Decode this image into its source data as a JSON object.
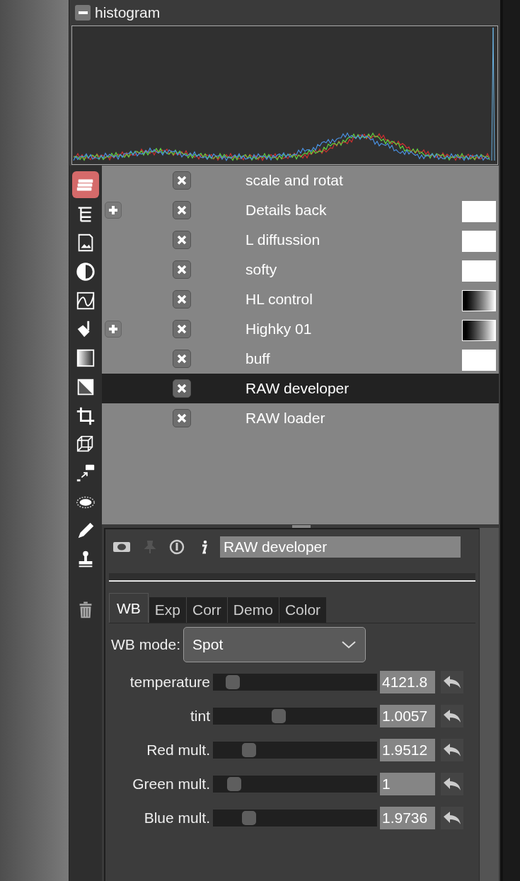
{
  "histogram": {
    "title": "histogram",
    "expanded": true
  },
  "tools": [
    {
      "kind": "layers",
      "selected": true
    },
    {
      "kind": "tree",
      "selected": false
    },
    {
      "kind": "image",
      "selected": false
    },
    {
      "kind": "contrast",
      "selected": false
    },
    {
      "kind": "curve",
      "selected": false
    },
    {
      "kind": "bucket",
      "selected": false
    },
    {
      "kind": "gradient",
      "selected": false
    },
    {
      "kind": "diagonal",
      "selected": false
    },
    {
      "kind": "crop",
      "selected": false
    },
    {
      "kind": "cube",
      "selected": false
    },
    {
      "kind": "resize",
      "selected": false
    },
    {
      "kind": "ellipse",
      "selected": false
    },
    {
      "kind": "pencil",
      "selected": false
    },
    {
      "kind": "stamp",
      "selected": false
    },
    {
      "kind": "trash",
      "selected": false
    }
  ],
  "layers": [
    {
      "name": "scale and rotat",
      "expandable": false,
      "visible": true,
      "selected": false
    },
    {
      "name": "Details back",
      "expandable": true,
      "visible": true,
      "mask": {
        "kind": "white"
      },
      "selected": false
    },
    {
      "name": "L diffussion",
      "expandable": false,
      "visible": true,
      "mask": {
        "kind": "white"
      },
      "selected": false
    },
    {
      "name": "softy",
      "expandable": false,
      "visible": true,
      "mask": {
        "kind": "white"
      },
      "selected": false
    },
    {
      "name": "HL control",
      "expandable": false,
      "visible": true,
      "mask": {
        "kind": "gradient"
      },
      "selected": false
    },
    {
      "name": "Highky 01",
      "expandable": true,
      "visible": true,
      "mask": {
        "kind": "gradient"
      },
      "selected": false
    },
    {
      "name": "buff",
      "expandable": false,
      "visible": true,
      "mask": {
        "kind": "white"
      },
      "selected": false
    },
    {
      "name": "RAW developer",
      "expandable": false,
      "visible": true,
      "selected": true
    },
    {
      "name": "RAW loader",
      "expandable": false,
      "visible": true,
      "selected": false
    }
  ],
  "module": {
    "name": "RAW developer",
    "tabs": [
      {
        "label": "WB",
        "selected": true
      },
      {
        "label": "Exp",
        "selected": false
      },
      {
        "label": "Corr",
        "selected": false
      },
      {
        "label": "Demo",
        "selected": false
      },
      {
        "label": "Color",
        "selected": false
      }
    ],
    "wb_mode": {
      "label": "WB mode:",
      "value": "Spot"
    },
    "sliders": [
      {
        "label": "temperature",
        "level": 0.12,
        "reading": "4121.8"
      },
      {
        "label": "tint",
        "level": 0.4,
        "reading": "1.0057"
      },
      {
        "label": "Red mult.",
        "level": 0.22,
        "reading": "1.9512"
      },
      {
        "label": "Green mult.",
        "level": 0.13,
        "reading": "1"
      },
      {
        "label": "Blue mult.",
        "level": 0.22,
        "reading": "1.9736"
      }
    ]
  }
}
